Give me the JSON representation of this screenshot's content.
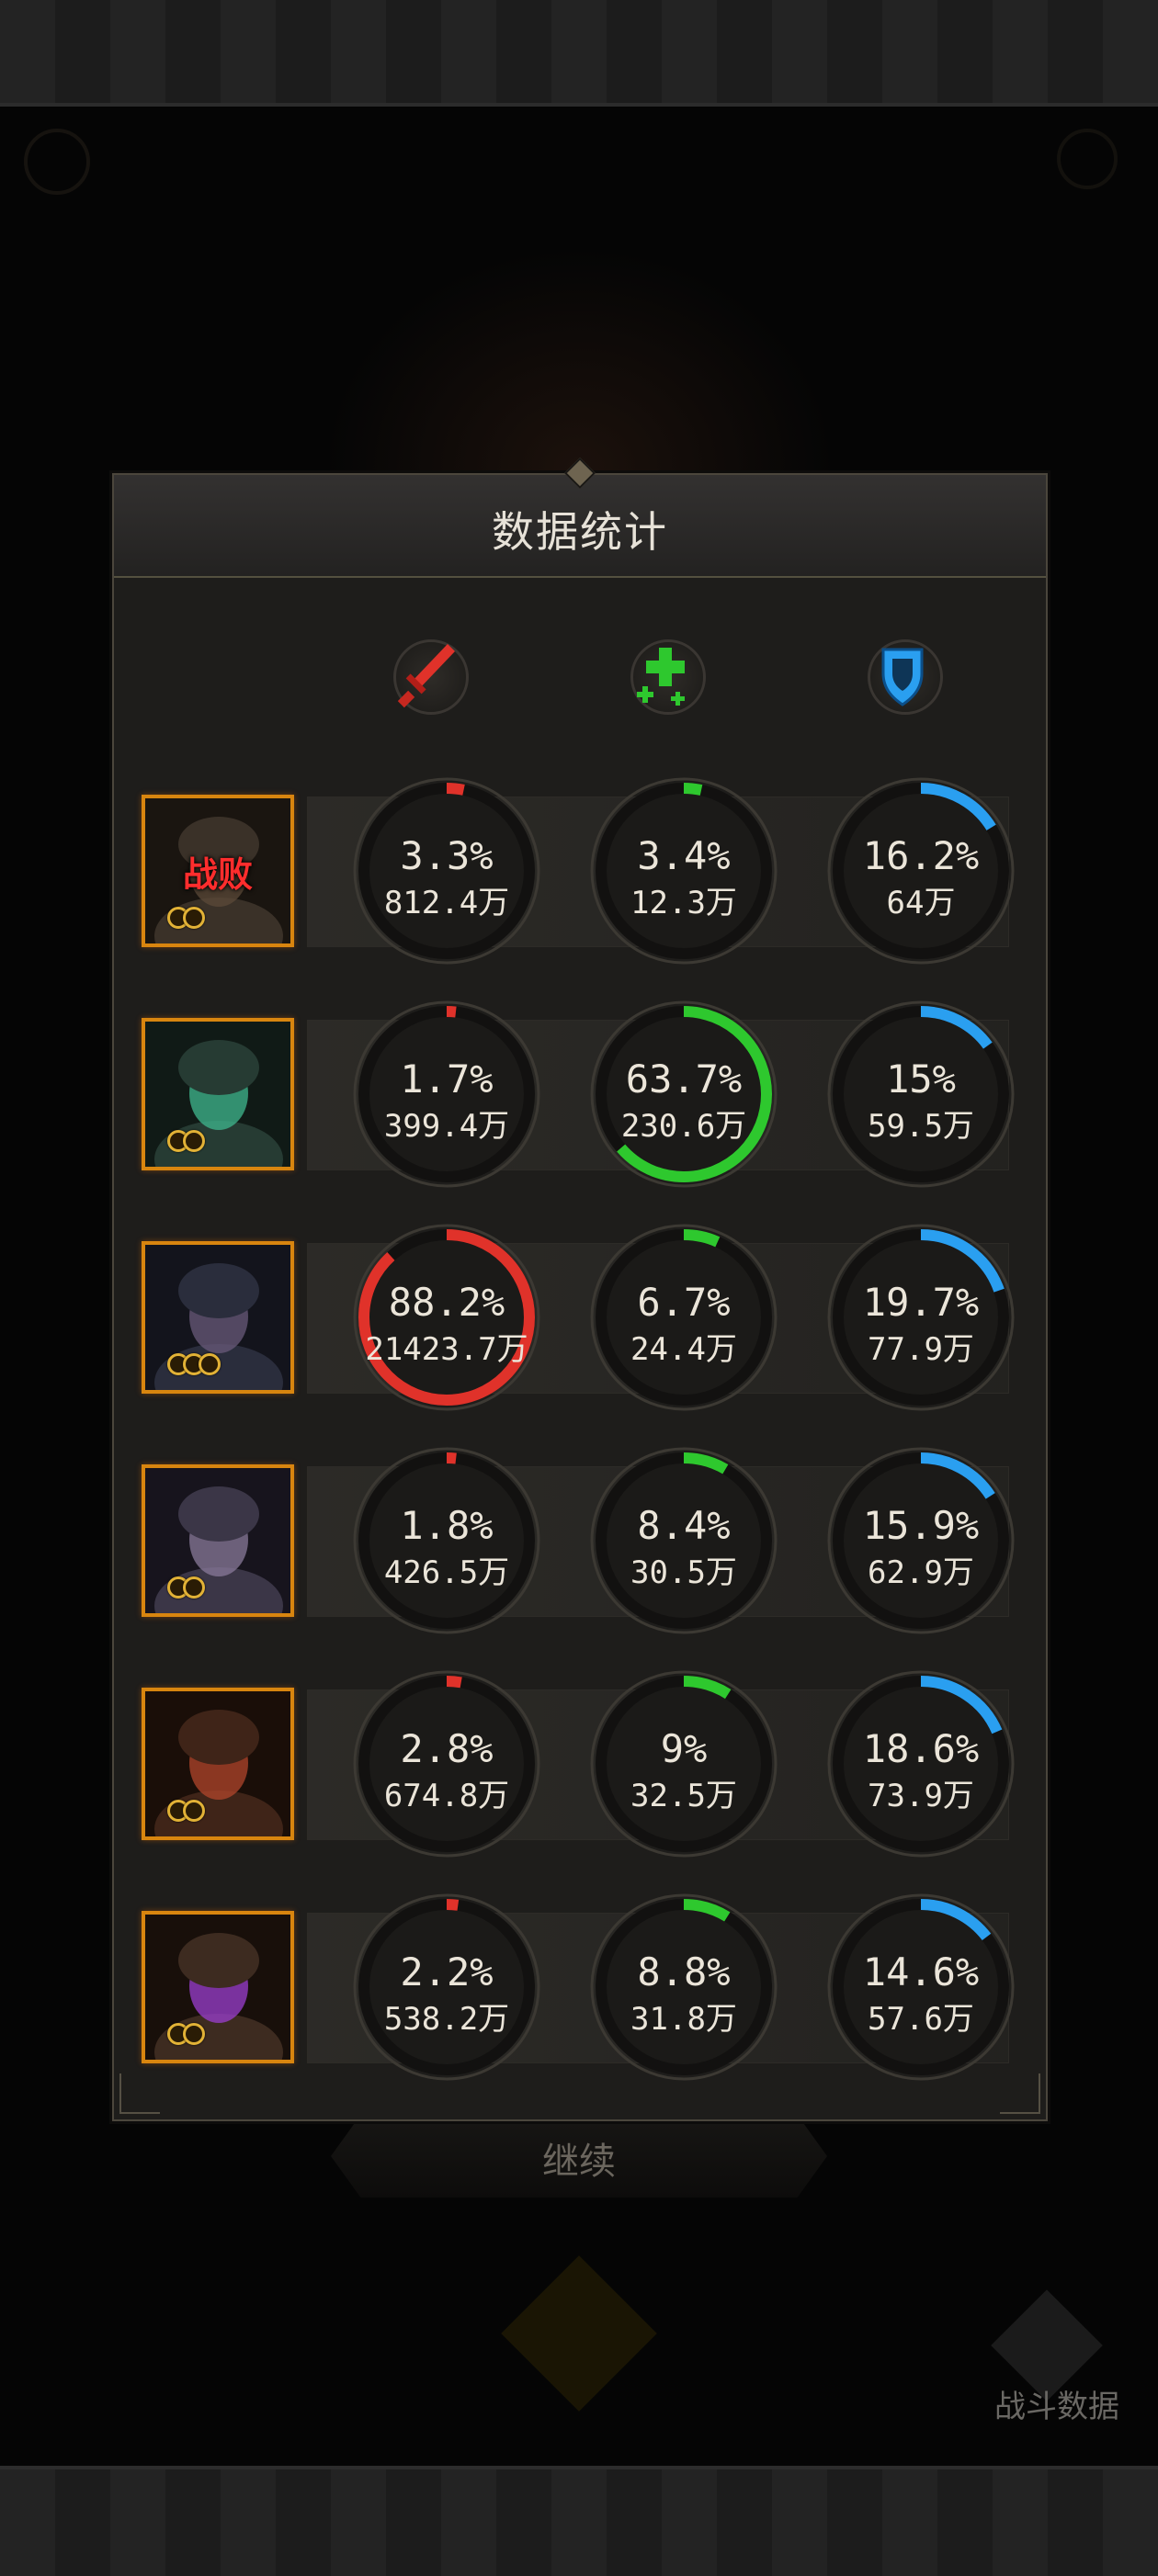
{
  "panel": {
    "title": "数据统计"
  },
  "columns": [
    {
      "icon": "sword-icon",
      "color": "#e0322a"
    },
    {
      "icon": "heal-cross-icon",
      "color": "#2ec82e"
    },
    {
      "icon": "shield-icon",
      "color": "#2a9ff0"
    }
  ],
  "heroes": [
    {
      "name": "hero-1",
      "defeated": true,
      "defeat_label": "战败",
      "stars": 2,
      "damage": {
        "percent": "3.3%",
        "amount": "812.4万",
        "fraction": 0.033
      },
      "heal": {
        "percent": "3.4%",
        "amount": "12.3万",
        "fraction": 0.034
      },
      "tank": {
        "percent": "16.2%",
        "amount": "64万",
        "fraction": 0.162
      }
    },
    {
      "name": "hero-2",
      "defeated": false,
      "stars": 2,
      "damage": {
        "percent": "1.7%",
        "amount": "399.4万",
        "fraction": 0.017
      },
      "heal": {
        "percent": "63.7%",
        "amount": "230.6万",
        "fraction": 0.637
      },
      "tank": {
        "percent": "15%",
        "amount": "59.5万",
        "fraction": 0.15
      }
    },
    {
      "name": "hero-3",
      "defeated": false,
      "stars": 3,
      "damage": {
        "percent": "88.2%",
        "amount": "21423.7万",
        "fraction": 0.882
      },
      "heal": {
        "percent": "6.7%",
        "amount": "24.4万",
        "fraction": 0.067
      },
      "tank": {
        "percent": "19.7%",
        "amount": "77.9万",
        "fraction": 0.197
      }
    },
    {
      "name": "hero-4",
      "defeated": false,
      "stars": 2,
      "damage": {
        "percent": "1.8%",
        "amount": "426.5万",
        "fraction": 0.018
      },
      "heal": {
        "percent": "8.4%",
        "amount": "30.5万",
        "fraction": 0.084
      },
      "tank": {
        "percent": "15.9%",
        "amount": "62.9万",
        "fraction": 0.159
      }
    },
    {
      "name": "hero-5",
      "defeated": false,
      "stars": 2,
      "damage": {
        "percent": "2.8%",
        "amount": "674.8万",
        "fraction": 0.028
      },
      "heal": {
        "percent": "9%",
        "amount": "32.5万",
        "fraction": 0.09
      },
      "tank": {
        "percent": "18.6%",
        "amount": "73.9万",
        "fraction": 0.186
      }
    },
    {
      "name": "hero-6",
      "defeated": false,
      "stars": 2,
      "damage": {
        "percent": "2.2%",
        "amount": "538.2万",
        "fraction": 0.022
      },
      "heal": {
        "percent": "8.8%",
        "amount": "31.8万",
        "fraction": 0.088
      },
      "tank": {
        "percent": "14.6%",
        "amount": "57.6万",
        "fraction": 0.146
      }
    }
  ],
  "continue_button": {
    "label": "继续"
  },
  "battle_data_button": {
    "label": "战斗数据"
  }
}
